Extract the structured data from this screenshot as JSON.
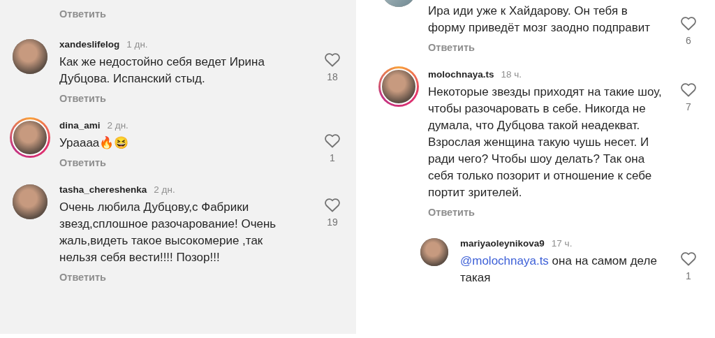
{
  "panels": [
    {
      "comments": [
        {
          "kind": "tail",
          "reply_label": "Ответить"
        },
        {
          "kind": "comment",
          "username": "xandeslifelog",
          "time": "1 дн.",
          "text": "Как же недостойно себя ведет Ирина Дубцова. Испанский стыд.",
          "likes": "18",
          "story_ring": false,
          "reply_label": "Ответить"
        },
        {
          "kind": "comment",
          "username": "dina_ami",
          "time": "2 дн.",
          "text": "Ураааа🔥😆",
          "likes": "1",
          "story_ring": true,
          "reply_label": "Ответить"
        },
        {
          "kind": "comment",
          "username": "tasha_chereshenka",
          "time": "2 дн.",
          "text": "Очень любила Дубцову,с Фабрики звезд,сплошное разочарование! Очень жаль,видеть такое высокомерие ,так нельзя себя вести!!!! Позор!!!",
          "likes": "19",
          "story_ring": false,
          "reply_label": "Ответить"
        }
      ]
    },
    {
      "comments": [
        {
          "kind": "cut",
          "text": "Ира иди уже к Хайдарову. Он тебя в форму приведёт мозг заодно подправит",
          "likes": "6",
          "story_ring": false,
          "reply_label": "Ответить"
        },
        {
          "kind": "comment",
          "username": "molochnaya.ts",
          "time": "18 ч.",
          "text": "Некоторые звезды приходят на такие шоу, чтобы разочаровать в себе. Никогда не думала, что Дубцова такой неадекват. Взрослая женщина такую чушь несет. И ради чего? Чтобы шоу делать? Так она себя только позорит и отношение к себе портит зрителей.",
          "likes": "7",
          "story_ring": true,
          "reply_label": "Ответить",
          "children": [
            {
              "kind": "comment",
              "username": "mariyaoleynikova9",
              "time": "17 ч.",
              "mention": "@molochnaya.ts",
              "text": "она на самом деле такая",
              "likes": "1",
              "story_ring": false
            }
          ]
        }
      ]
    }
  ]
}
